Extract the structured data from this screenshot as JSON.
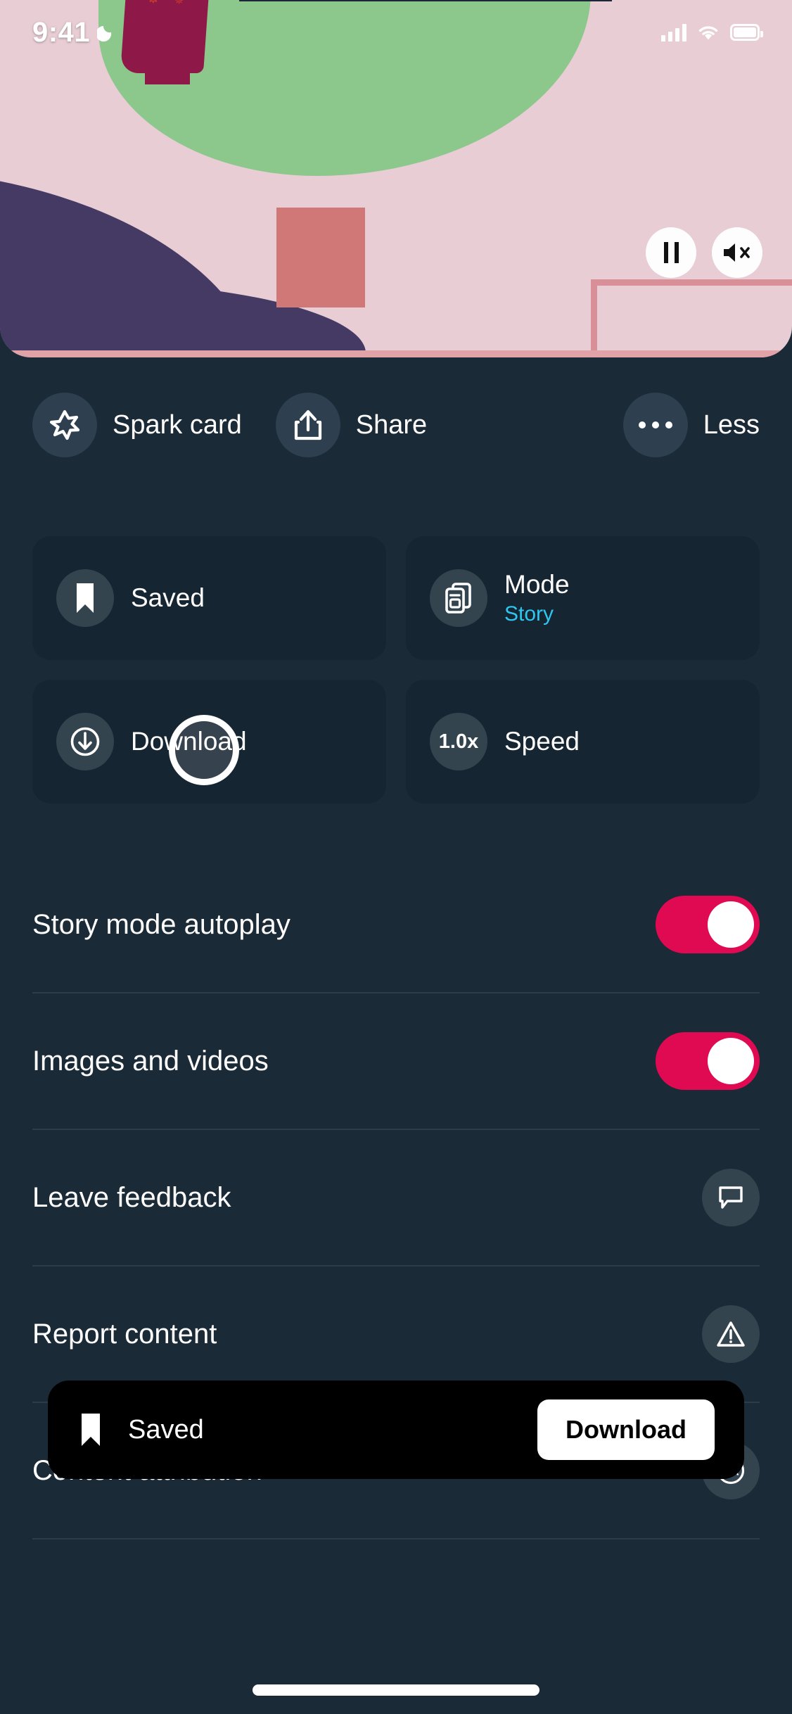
{
  "status_bar": {
    "time": "9:41",
    "moon_icon": "crescent-moon-icon",
    "signal_icon": "cellular-signal-icon",
    "wifi_icon": "wifi-icon",
    "battery_icon": "battery-full-icon"
  },
  "media": {
    "pause_icon": "pause-icon",
    "mute_icon": "speaker-mute-icon",
    "artwork_alt": "illustration-head-with-gears-and-audio-waveform"
  },
  "action_row": [
    {
      "label": "Spark card",
      "icon": "spark-star-icon",
      "name": "spark-card-button"
    },
    {
      "label": "Share",
      "icon": "share-upload-icon",
      "name": "share-button"
    },
    {
      "label": "Less",
      "icon": "more-dots-icon",
      "name": "less-button"
    }
  ],
  "cards": [
    {
      "title": "Saved",
      "subtitle": "",
      "icon": "bookmark-filled-icon",
      "name": "saved-card"
    },
    {
      "title": "Mode",
      "subtitle": "Story",
      "icon": "stacked-cards-icon",
      "name": "mode-card"
    },
    {
      "title": "Download",
      "subtitle": "",
      "icon": "download-circle-arrow-icon",
      "name": "download-card"
    },
    {
      "title": "Speed",
      "subtitle": "",
      "icon": "1.0x",
      "name": "speed-card"
    }
  ],
  "settings": [
    {
      "label": "Story mode autoplay",
      "control": "toggle",
      "value": "on",
      "name": "story-mode-autoplay-row"
    },
    {
      "label": "Images and videos",
      "control": "toggle",
      "value": "on",
      "name": "images-and-videos-row"
    },
    {
      "label": "Leave feedback",
      "control": "icon",
      "icon": "chat-bubble-icon",
      "name": "leave-feedback-row"
    },
    {
      "label": "Report content",
      "control": "icon",
      "icon": "warning-triangle-icon",
      "name": "report-content-row"
    },
    {
      "label": "Content attribution",
      "control": "icon",
      "icon": "content-credentials-ca-icon",
      "name": "content-attribution-row"
    }
  ],
  "toast": {
    "label": "Saved",
    "icon": "bookmark-filled-icon",
    "button_label": "Download"
  },
  "colors": {
    "background": "#1a2a37",
    "card": "#152532",
    "accent_toggle": "#e00a52",
    "accent_cyan": "#2ec6f0",
    "icon_circle": "#33444f",
    "toast_background": "#000000",
    "divider": "#2a3d4c"
  },
  "speed_value": "1.0x"
}
